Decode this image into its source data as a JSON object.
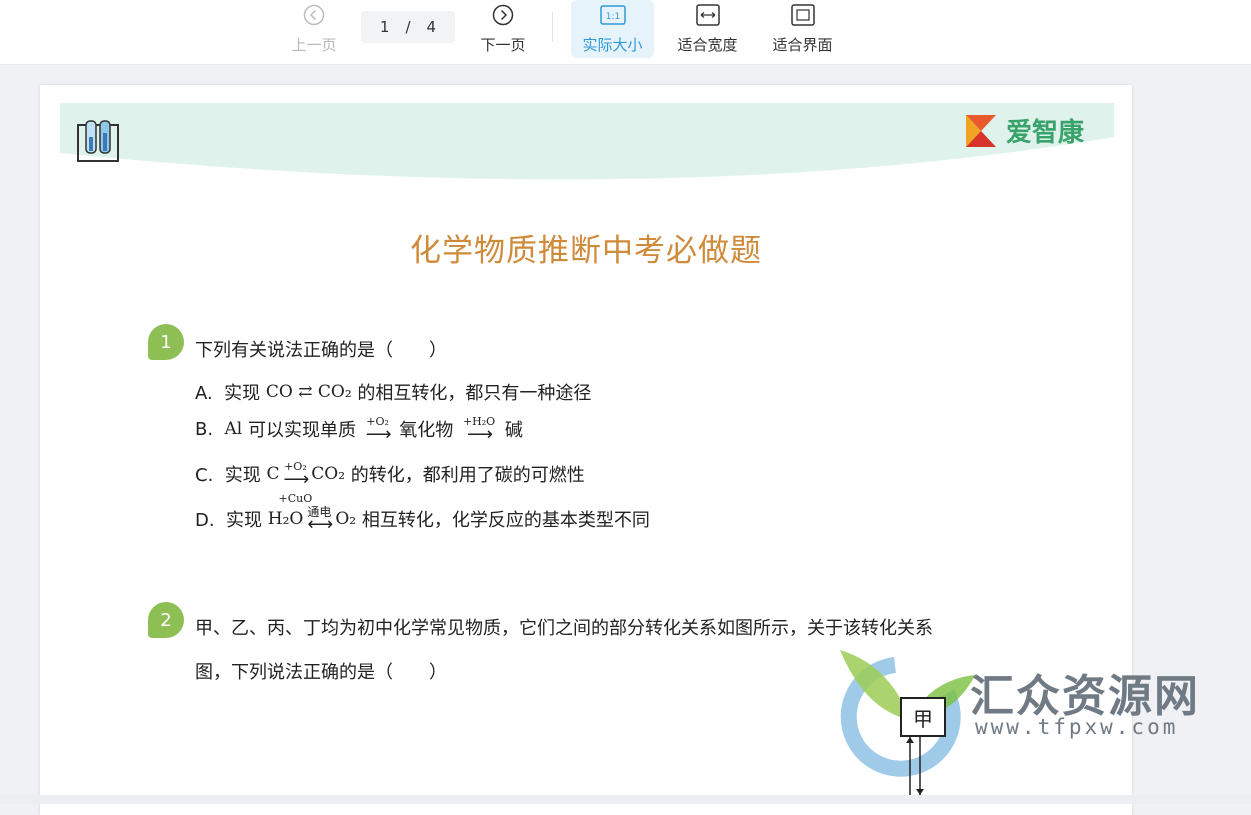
{
  "toolbar": {
    "prev_label": "上一页",
    "next_label": "下一页",
    "current_page": "1",
    "page_sep": "/",
    "total_pages": "4",
    "actual_size_label": "实际大小",
    "actual_size_icon_text": "1:1",
    "fit_width_label": "适合宽度",
    "fit_page_label": "适合界面"
  },
  "document": {
    "brand": "爱智康",
    "title": "化学物质推断中考必做题",
    "q1": {
      "number": "1",
      "stem": "下列有关说法正确的是（　　）",
      "a": {
        "prefix": "A.  实现 ",
        "chem": "CO ⇄ CO₂",
        "rest": " 的相互转化，都只有一种途径"
      },
      "b": {
        "prefix": "B.  ",
        "chem": "Al",
        "mid": " 可以实现单质 ",
        "arrow1": "+O₂",
        "mid2": " 氧化物 ",
        "arrow2": "+H₂O",
        "rest": " 碱"
      },
      "c": {
        "prefix": "C.  实现 ",
        "chem": "C",
        "arrow_top": "+O₂",
        "arrow_bot": "+CuO",
        "chem2": "CO₂",
        "rest": " 的转化，都利用了碳的可燃性"
      },
      "d": {
        "prefix": "D.  实现 ",
        "chem": "H₂O",
        "arrow_top": "通电",
        "chem2": "O₂",
        "rest": " 相互转化，化学反应的基本类型不同"
      }
    },
    "q2": {
      "number": "2",
      "line1": "甲、乙、丙、丁均为初中化学常见物质，它们之间的部分转化关系如图所示，关于该转化关系",
      "line2": "图，下列说法正确的是（　　）",
      "diagram_node": "甲"
    }
  },
  "watermark": {
    "title": "汇众资源网",
    "url": "www.tfpxw.com"
  },
  "colors": {
    "accent": "#2d9ad8",
    "title": "#cf8a3a",
    "badge": "#8dbf55",
    "banner": "#dff3ec"
  }
}
